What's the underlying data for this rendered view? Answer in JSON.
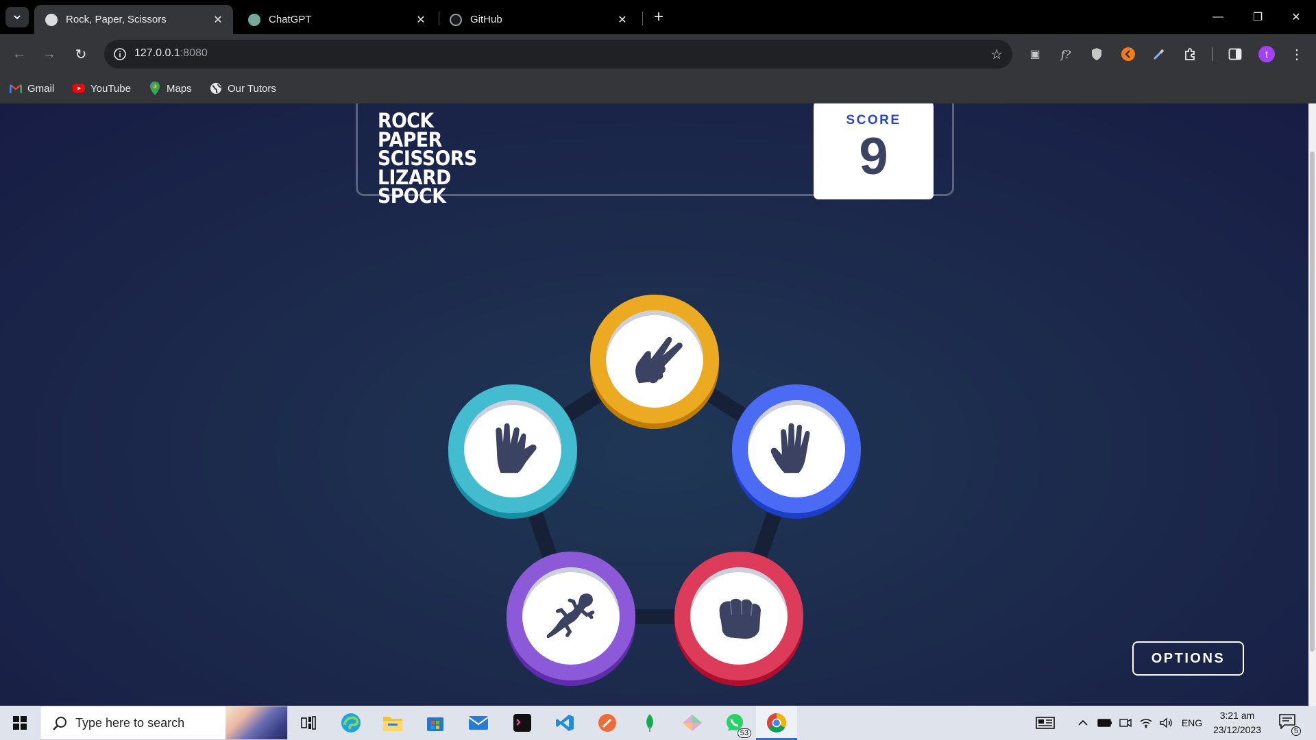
{
  "browser": {
    "tabs": [
      {
        "title": "Rock, Paper, Scissors",
        "active": true
      },
      {
        "title": "ChatGPT",
        "active": false
      },
      {
        "title": "GitHub",
        "active": false
      }
    ],
    "address": {
      "host": "127.0.0.1",
      "port": ":8080"
    },
    "bookmarks": [
      {
        "label": "Gmail",
        "icon": "gmail-icon"
      },
      {
        "label": "YouTube",
        "icon": "youtube-icon"
      },
      {
        "label": "Maps",
        "icon": "maps-icon"
      },
      {
        "label": "Our Tutors",
        "icon": "globe-icon"
      }
    ],
    "profile_initial": "t"
  },
  "game": {
    "title_lines": [
      "ROCK",
      "PAPER",
      "SCISSORS",
      "LIZARD",
      "SPOCK"
    ],
    "score_label": "SCORE",
    "score": "9",
    "tokens": [
      {
        "name": "scissors",
        "color": "#eca922"
      },
      {
        "name": "paper",
        "color": "#4b6bf4"
      },
      {
        "name": "rock",
        "color": "#dd3b5a"
      },
      {
        "name": "lizard",
        "color": "#8c5ad8"
      },
      {
        "name": "spock",
        "color": "#44bcd0"
      }
    ],
    "options_label": "OPTIONS"
  },
  "taskbar": {
    "search_placeholder": "Type here to search",
    "whatsapp_badge": "53",
    "language": "ENG",
    "time": "3:21 am",
    "date": "23/12/2023",
    "notifications": "5"
  }
}
